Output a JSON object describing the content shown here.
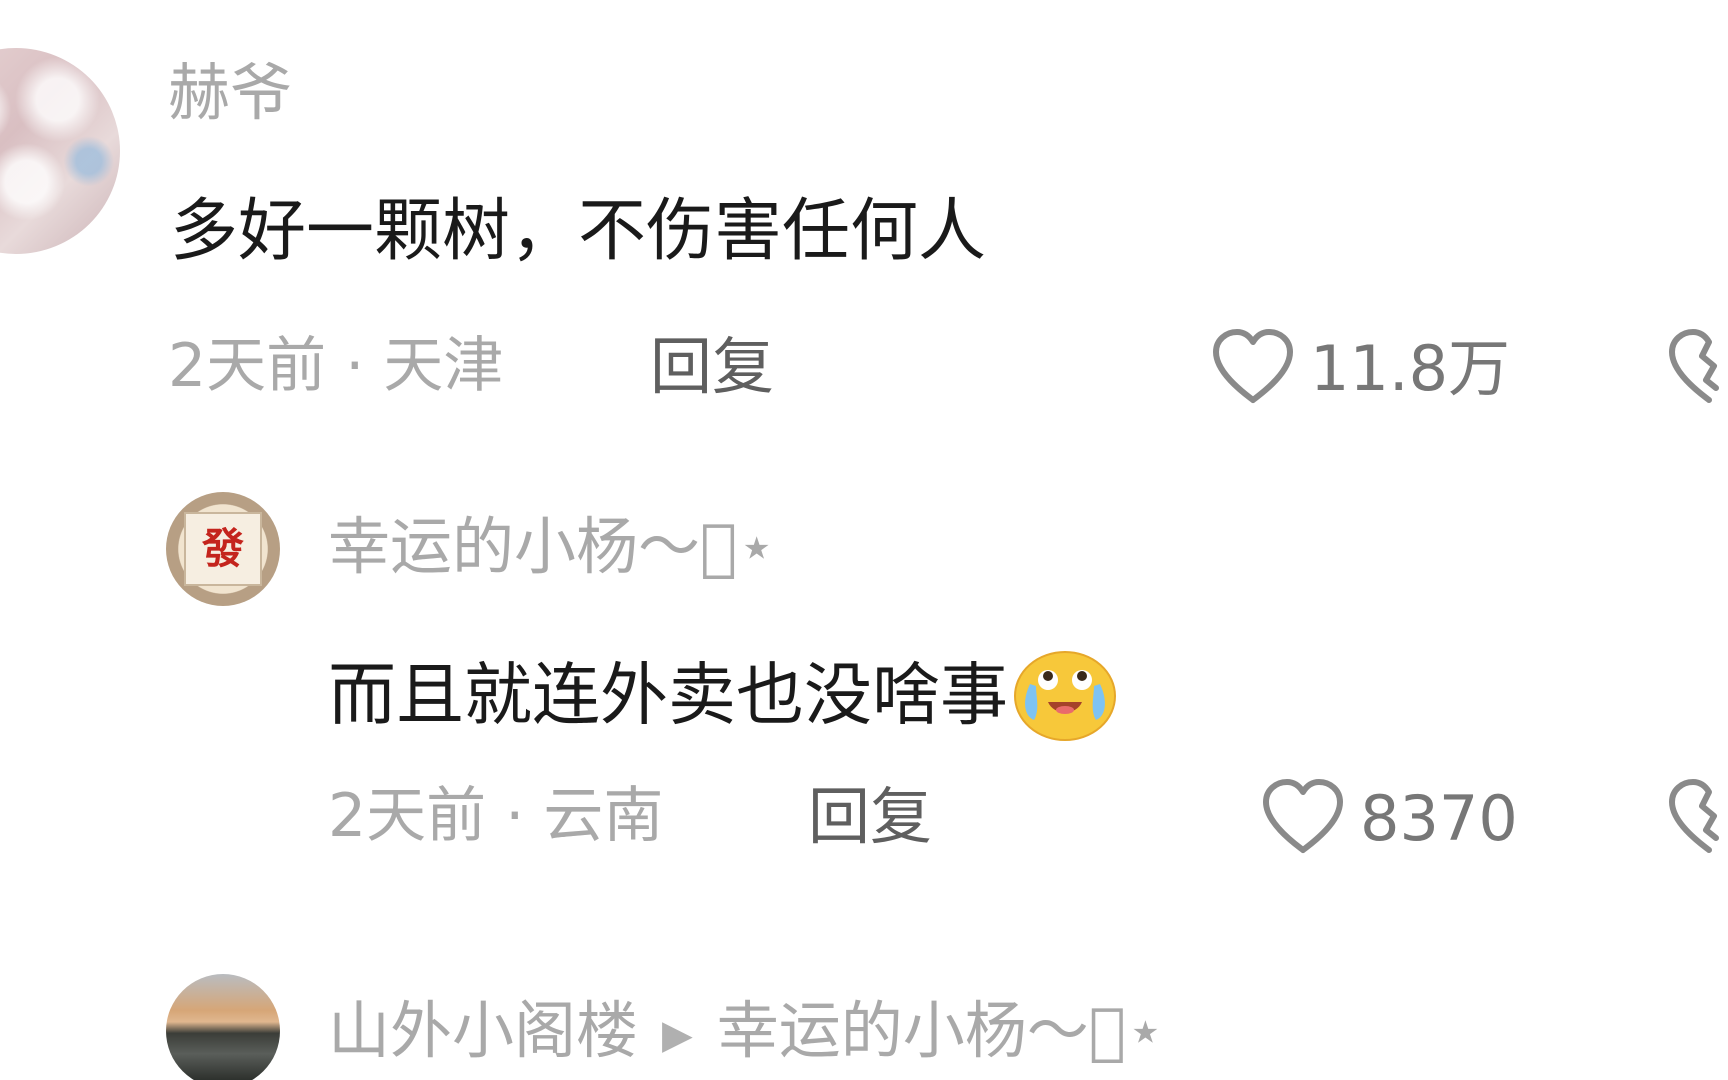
{
  "colors": {
    "username": "#a9a9a9",
    "comment_text": "#1a1a1a",
    "meta": "#a9a9a9",
    "reply": "#5f5f5f",
    "icon": "#8a8a8a"
  },
  "comments": [
    {
      "username": "赫爷",
      "text": "多好一颗树，不伤害任何人",
      "meta": "2天前 · 天津",
      "reply_label": "回复",
      "likes": "11.8万",
      "like_icon": "heart-outline-icon",
      "dislike_icon": "broken-heart-icon"
    },
    {
      "username": "幸运的小杨～\u0000⋆",
      "text": "而且就连外卖也没啥事",
      "emoji": "laughing-crying-emoji",
      "meta": "2天前 · 云南",
      "reply_label": "回复",
      "likes": "8370",
      "like_icon": "heart-outline-icon",
      "dislike_icon": "broken-heart-icon"
    },
    {
      "username": "山外小阁楼",
      "reply_to": "幸运的小杨～\u0000⋆"
    }
  ],
  "avatars": {
    "reply1_stamp": "發"
  }
}
